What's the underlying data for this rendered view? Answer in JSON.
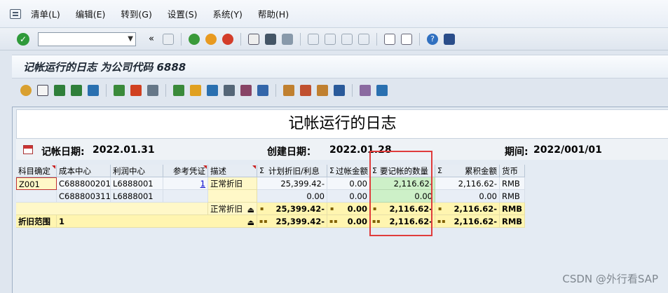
{
  "menu": [
    "清单(L)",
    "编辑(E)",
    "转到(G)",
    "设置(S)",
    "系统(Y)",
    "帮助(H)"
  ],
  "command_field": {
    "value": ""
  },
  "window_title": "记帐运行的日志 为公司代码 6888",
  "report_title": "记帐运行的日志",
  "header": {
    "posting_date_label": "记帐日期:",
    "posting_date": "2022.01.31",
    "created_date_label": "创建日期：",
    "created_date": "2022.01.28",
    "period_label": "期间:",
    "period": "2022/001/01"
  },
  "columns": [
    "科目确定",
    "成本中心",
    "利润中心",
    "参考凭证",
    "描述",
    "计划折旧/利息",
    "过帐金额",
    "要记帐的数量",
    "累积金额",
    "货币"
  ],
  "rows": [
    {
      "acct": "Z001",
      "cost_center": "C688800201",
      "profit_center": "L6888001",
      "ref": "1",
      "desc": "正常折旧",
      "planned": "25,399.42-",
      "posted": "0.00",
      "to_post": "2,116.62-",
      "cumulative": "2,116.62-",
      "currency": "RMB"
    },
    {
      "acct": "",
      "cost_center": "C688800311",
      "profit_center": "L6888001",
      "ref": "",
      "desc": "",
      "planned": "0.00",
      "posted": "0.00",
      "to_post": "0.00",
      "cumulative": "0.00",
      "currency": "RMB"
    }
  ],
  "subtotal": {
    "desc": "正常折旧",
    "planned": "25,399.42-",
    "posted": "0.00",
    "to_post": "2,116.62-",
    "cumulative": "2,116.62-",
    "currency": "RMB"
  },
  "total": {
    "label": "折旧范围",
    "value": "1",
    "planned": "25,399.42-",
    "posted": "0.00",
    "to_post": "2,116.62-",
    "cumulative": "2,116.62-",
    "currency": "RMB"
  },
  "watermark": "CSDN @外行看SAP"
}
